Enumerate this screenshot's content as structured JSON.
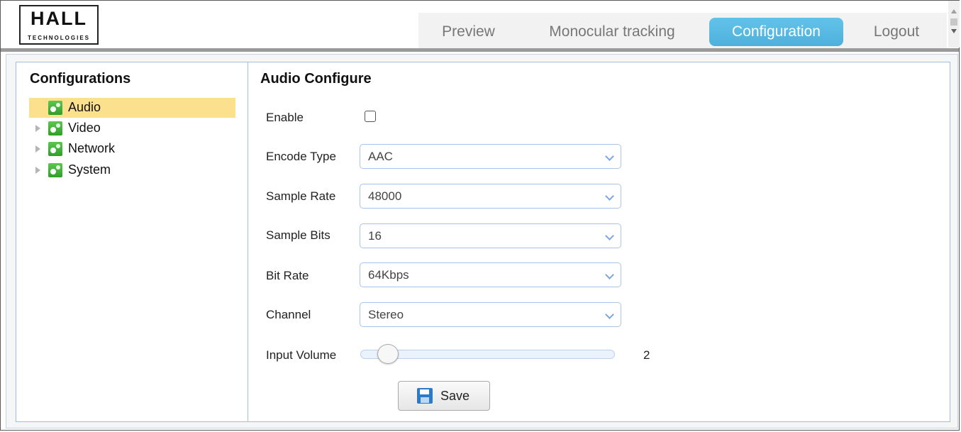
{
  "header": {
    "logo_text": "HALL",
    "logo_sub": "TECHNOLOGIES",
    "nav": [
      {
        "label": "Preview"
      },
      {
        "label": "Monocular tracking"
      },
      {
        "label": "Configuration"
      },
      {
        "label": "Logout"
      }
    ],
    "active_nav": "Configuration",
    "active_color": "#56b8e2"
  },
  "sidebar": {
    "title": "Configurations",
    "items": [
      {
        "label": "Audio"
      },
      {
        "label": "Video"
      },
      {
        "label": "Network"
      },
      {
        "label": "System"
      }
    ],
    "selected": "Audio",
    "selected_color": "#fbe08e",
    "icon": "gears-icon"
  },
  "content": {
    "title": "Audio Configure",
    "enable_label": "Enable",
    "enable_checked": false,
    "fields": [
      {
        "label": "Encode Type",
        "value": "AAC"
      },
      {
        "label": "Sample Rate",
        "value": "48000"
      },
      {
        "label": "Sample Bits",
        "value": "16"
      },
      {
        "label": "Bit Rate",
        "value": "64Kbps"
      },
      {
        "label": "Channel",
        "value": "Stereo"
      }
    ],
    "input_volume": {
      "label": "Input Volume",
      "value": "2"
    },
    "save_label": "Save"
  }
}
